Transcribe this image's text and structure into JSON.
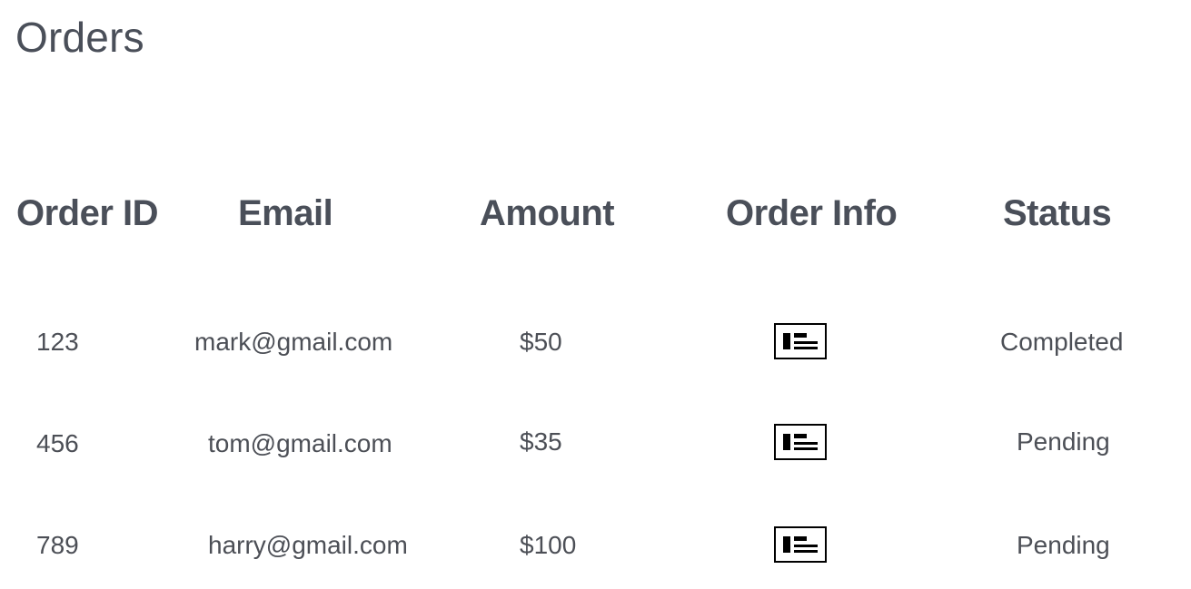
{
  "page": {
    "title": "Orders"
  },
  "table": {
    "headers": [
      "Order ID",
      "Email",
      "Amount",
      "Order Info",
      "Status"
    ],
    "rows": [
      {
        "order_id": "123",
        "email": "mark@gmail.com",
        "amount": "$50",
        "info_icon": "order-info-icon",
        "status": "Completed"
      },
      {
        "order_id": "456",
        "email": "tom@gmail.com",
        "amount": "$35",
        "info_icon": "order-info-icon",
        "status": "Pending"
      },
      {
        "order_id": "789",
        "email": "harry@gmail.com",
        "amount": "$100",
        "info_icon": "order-info-icon",
        "status": "Pending"
      }
    ]
  },
  "colors": {
    "text": "#4a4f59",
    "icon": "#000000",
    "background": "#ffffff"
  }
}
